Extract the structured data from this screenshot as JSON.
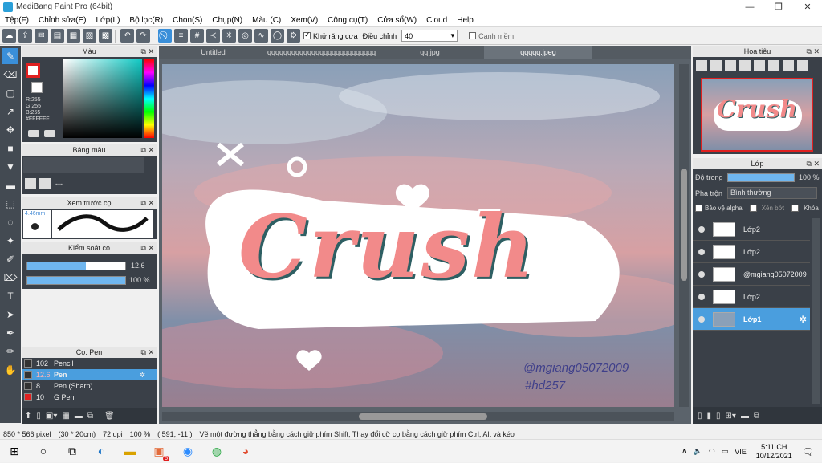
{
  "window": {
    "title": "MediBang Paint Pro (64bit)",
    "min": "—",
    "max": "❐",
    "close": "✕"
  },
  "menu": [
    "Tệp(F)",
    "Chỉnh sửa(E)",
    "Lớp(L)",
    "Bộ lọc(R)",
    "Chọn(S)",
    "Chụp(N)",
    "Màu (C)",
    "Xem(V)",
    "Công cụ(T)",
    "Cửa sổ(W)",
    "Cloud",
    "Help"
  ],
  "toolbar": {
    "antialias_label": "Khử răng cưa",
    "correction_label": "Điều chỉnh",
    "correction_value": "40",
    "smooth_label": "Cạnh mềm"
  },
  "color_panel": {
    "title": "Màu",
    "r": "R:255",
    "g": "G:255",
    "b": "B:255",
    "hex": "#FFFFFF"
  },
  "palette_panel": {
    "title": "Bảng màu",
    "label": "---"
  },
  "brush_preview": {
    "title": "Xem trước cọ",
    "size": "4.46mm"
  },
  "brush_control": {
    "title": "Kiểm soát cọ",
    "size_value": "12.6",
    "opacity_value": "100 %",
    "size_fraction": 0.6,
    "opacity_fraction": 1.0
  },
  "brush_list": {
    "title": "Cọ: Pen",
    "items": [
      {
        "size": "102",
        "name": "Pencil",
        "color": "#333333"
      },
      {
        "size": "12.6",
        "name": "Pen",
        "color": "#333333"
      },
      {
        "size": "8",
        "name": "Pen (Sharp)",
        "color": "#333333"
      },
      {
        "size": "10",
        "name": "G Pen",
        "color": "#e02020"
      }
    ]
  },
  "tabs": [
    "Untitled",
    "qqqqqqqqqqqqqqqqqqqqqqqqqqq.jpg",
    "qq.jpg",
    "qqqqq.jpeg"
  ],
  "artwork": {
    "main_text": "Crush",
    "handle": "@mgiang05072009",
    "tag": "#hd257"
  },
  "navigator": {
    "title": "Hoa tiêu"
  },
  "layers_panel": {
    "title": "Lớp",
    "opacity_label": "Độ trong",
    "opacity_value": "100 %",
    "opacity_fraction": 1.0,
    "blend_label": "Pha trộn",
    "blend_value": "Bình thường",
    "protect_alpha": "Bảo vệ alpha",
    "clipping": "Xén bớt",
    "lock": "Khóa",
    "layers": [
      "Lớp2",
      "Lớp2",
      "@mgiang05072009",
      "Lớp2",
      "Lớp1"
    ]
  },
  "status": {
    "size": "850 * 566 pixel",
    "cm": "(30 * 20cm)",
    "dpi": "72 dpi",
    "zoom": "100 %",
    "coords": "( 591, -11 )",
    "hint": "Vẽ một đường thẳng bằng cách giữ phím Shift, Thay đổi cỡ cọ bằng cách giữ phím Ctrl, Alt và kéo"
  },
  "taskbar": {
    "lang": "VIE",
    "time": "5:11 CH",
    "date": "10/12/2021",
    "badge": "5"
  }
}
